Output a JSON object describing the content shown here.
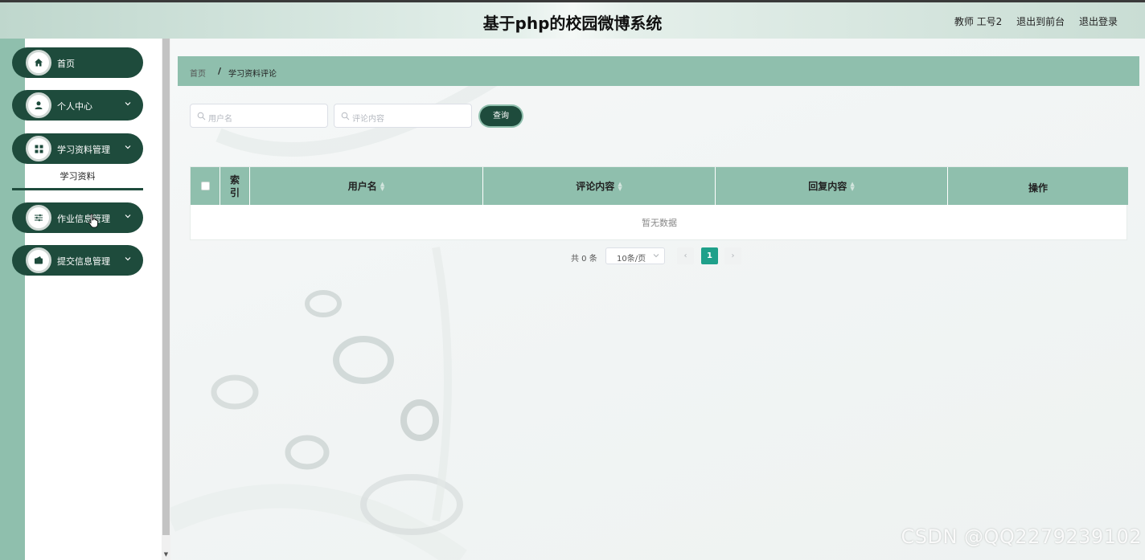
{
  "header": {
    "title": "基于php的校园微博系统",
    "user": "教师 工号2",
    "to_front": "退出到前台",
    "logout": "退出登录"
  },
  "sidebar": {
    "items": [
      {
        "label": "首页",
        "icon": "home-icon"
      },
      {
        "label": "个人中心",
        "icon": "user-icon"
      },
      {
        "label": "学习资料管理",
        "icon": "grid-icon"
      },
      {
        "label": "作业信息管理",
        "icon": "sliders-icon"
      },
      {
        "label": "提交信息管理",
        "icon": "wallet-icon"
      }
    ],
    "submenu": [
      "学习资料"
    ]
  },
  "breadcrumb": {
    "home": "首页",
    "separator": "/",
    "current": "学习资料评论"
  },
  "search": {
    "username_placeholder": "用户名",
    "comment_placeholder": "评论内容",
    "query_button": "查询"
  },
  "table": {
    "columns": [
      "索引",
      "用户名",
      "评论内容",
      "回复内容",
      "操作"
    ],
    "rows": [],
    "empty_text": "暂无数据"
  },
  "pagination": {
    "total": "共 0 条",
    "page_size": "10条/页",
    "current_page": "1",
    "prev": "‹",
    "next": "›"
  },
  "watermark": "CSDN @QQ2279239102",
  "colors": {
    "accent": "#8fbfad",
    "dark": "#1e4b3c",
    "page_active": "#1fa08a"
  }
}
